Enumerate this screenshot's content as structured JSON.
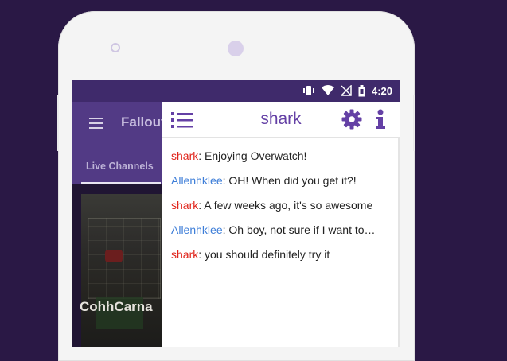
{
  "status_bar": {
    "time": "4:20"
  },
  "app_bar": {
    "title": "Fallout"
  },
  "tabs": {
    "active_label": "Live Channels"
  },
  "stream": {
    "channel_name": "CohhCarna"
  },
  "chat": {
    "title": "shark",
    "messages": [
      {
        "user": "shark",
        "text": ": Enjoying Overwatch!"
      },
      {
        "user": "Allenhklee",
        "text": ": OH! When did you get it?!"
      },
      {
        "user": "shark",
        "text": ": A few weeks ago, it's so awesome"
      },
      {
        "user": "Allenhklee",
        "text": ": Oh boy, not sure if I want to…"
      },
      {
        "user": "shark",
        "text": ": you should definitely try it"
      }
    ]
  },
  "colors": {
    "background": "#2a1845",
    "app_bar": "#523a85",
    "accent": "#6440a5",
    "user_red": "#e0241b",
    "user_blue": "#3e7ed8"
  }
}
